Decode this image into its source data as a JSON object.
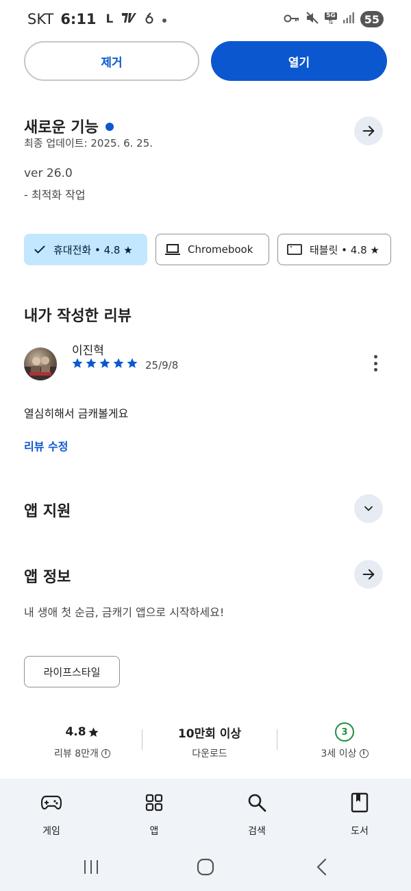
{
  "status_bar": {
    "carrier": "SKT",
    "time": "6:11",
    "network": "5G",
    "battery": "55"
  },
  "actions": {
    "remove_label": "제거",
    "open_label": "열기"
  },
  "whats_new": {
    "title": "새로운 기능",
    "last_updated": "최종 업데이트: 2025. 6. 25.",
    "version": "ver 26.0",
    "note": "- 최적화 작업"
  },
  "device_chips": [
    {
      "label": "휴대전화 • 4.8 ★",
      "selected": true
    },
    {
      "label": "Chromebook",
      "selected": false
    },
    {
      "label": "태블릿 • 4.8 ★",
      "selected": false
    }
  ],
  "my_review": {
    "title": "내가 작성한 리뷰",
    "reviewer": "이진혁",
    "rating": 5,
    "date": "25/9/8",
    "text": "열심히해서 금캐볼게요",
    "edit_label": "리뷰 수정"
  },
  "app_support": {
    "title": "앱 지원"
  },
  "app_info": {
    "title": "앱 정보",
    "description": "내 생애 첫 순금, 금캐기 앱으로 시작하세요!",
    "category": "라이프스타일"
  },
  "stats": {
    "rating_value": "4.8",
    "rating_label": "리뷰 8만개",
    "downloads_value": "10만회 이상",
    "downloads_label": "다운로드",
    "age_value": "3",
    "age_label": "3세 이상"
  },
  "bottom_nav": {
    "items": [
      {
        "label": "게임",
        "icon": "gamepad-icon"
      },
      {
        "label": "앱",
        "icon": "apps-grid-icon"
      },
      {
        "label": "검색",
        "icon": "search-icon"
      },
      {
        "label": "도서",
        "icon": "book-icon"
      }
    ]
  },
  "colors": {
    "accent": "#0b57d0",
    "chip_selected": "#c2e7ff",
    "round_button": "#e7ebf3",
    "nav_background": "#f0f4f9",
    "age_green": "#1e8e3e"
  }
}
